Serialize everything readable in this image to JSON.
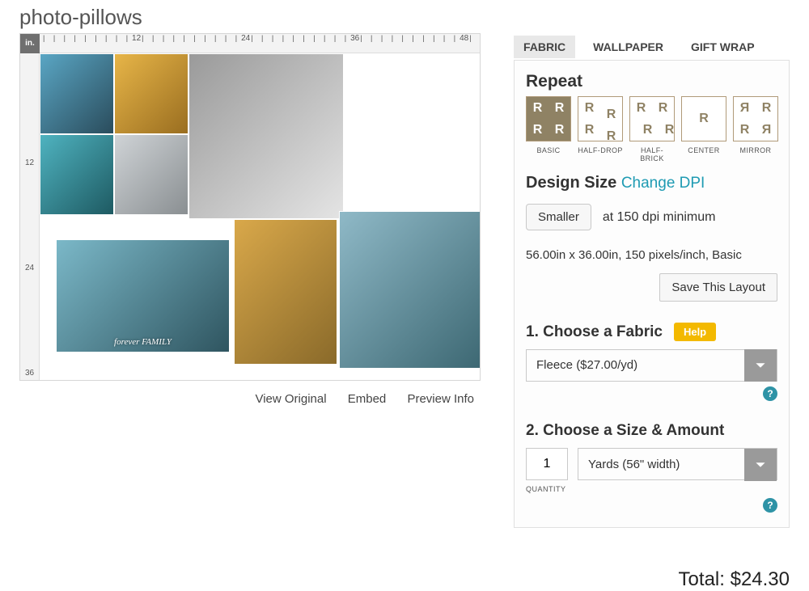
{
  "title": "photo-pillows",
  "ruler": {
    "unit": "in.",
    "hmarks": [
      12,
      24,
      36,
      48
    ],
    "vmarks": [
      12,
      24,
      36
    ]
  },
  "collage_caption": "forever FAMILY",
  "previewLinks": {
    "viewOriginal": "View Original",
    "embed": "Embed",
    "previewInfo": "Preview Info"
  },
  "tabs": {
    "fabric": "FABRIC",
    "wallpaper": "WALLPAPER",
    "giftwrap": "GIFT WRAP"
  },
  "repeat": {
    "heading": "Repeat",
    "options": [
      {
        "key": "basic",
        "label": "BASIC"
      },
      {
        "key": "halfdrop",
        "label": "HALF-DROP"
      },
      {
        "key": "halfbrick",
        "label": "HALF-BRICK"
      },
      {
        "key": "center",
        "label": "CENTER"
      },
      {
        "key": "mirror",
        "label": "MIRROR"
      }
    ]
  },
  "design": {
    "heading": "Design Size",
    "changeDpi": "Change DPI",
    "smallerBtn": "Smaller",
    "dpiNote": "at 150 dpi minimum",
    "dims": "56.00in x 36.00in, 150 pixels/inch, Basic",
    "saveBtn": "Save This Layout"
  },
  "fabric": {
    "heading": "1. Choose a Fabric",
    "help": "Help",
    "selected": "Fleece ($27.00/yd)"
  },
  "size": {
    "heading": "2. Choose a Size & Amount",
    "qty": "1",
    "qtyLabel": "QUANTITY",
    "unit": "Yards (56\" width)"
  },
  "total": {
    "label": "Total:",
    "price": "$24.30"
  }
}
